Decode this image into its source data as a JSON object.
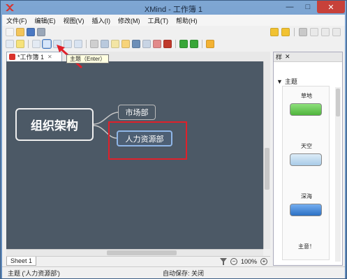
{
  "window": {
    "title": "XMind - 工作簿 1",
    "minimize": "—",
    "maximize": "□",
    "close": "✕"
  },
  "menu": {
    "items": [
      "文件(F)",
      "编辑(E)",
      "视图(V)",
      "插入(I)",
      "修改(M)",
      "工具(T)",
      "帮助(H)"
    ]
  },
  "editor": {
    "tab_label": "*工作簿 1",
    "tab_close": "✕"
  },
  "tooltip": {
    "text": "主题（Enter）"
  },
  "mindmap": {
    "central_topic": "组织架构",
    "subtopics": [
      "市场部",
      "人力资源部"
    ]
  },
  "sheetbar": {
    "sheet_label": "Sheet 1",
    "zoom_value": "100%",
    "zoom_out": "−",
    "zoom_in": "+"
  },
  "right_panel": {
    "tab_label": "样",
    "section_title": "主题",
    "themes": [
      {
        "name": "草地",
        "color": "#6ccd5a"
      },
      {
        "name": "天空",
        "color": "#b9d9f0"
      },
      {
        "name": "深海",
        "color": "#3f86d6"
      },
      {
        "name": "主意！",
        "color": "#ffffff"
      }
    ]
  },
  "statusbar": {
    "selection": "主题 ('人力资源部')",
    "autosave": "自动保存: 关闭"
  },
  "colors": {
    "canvas_bg": "#4c5966",
    "highlight": "#e0202a",
    "selected_border": "#8fb6e8"
  }
}
